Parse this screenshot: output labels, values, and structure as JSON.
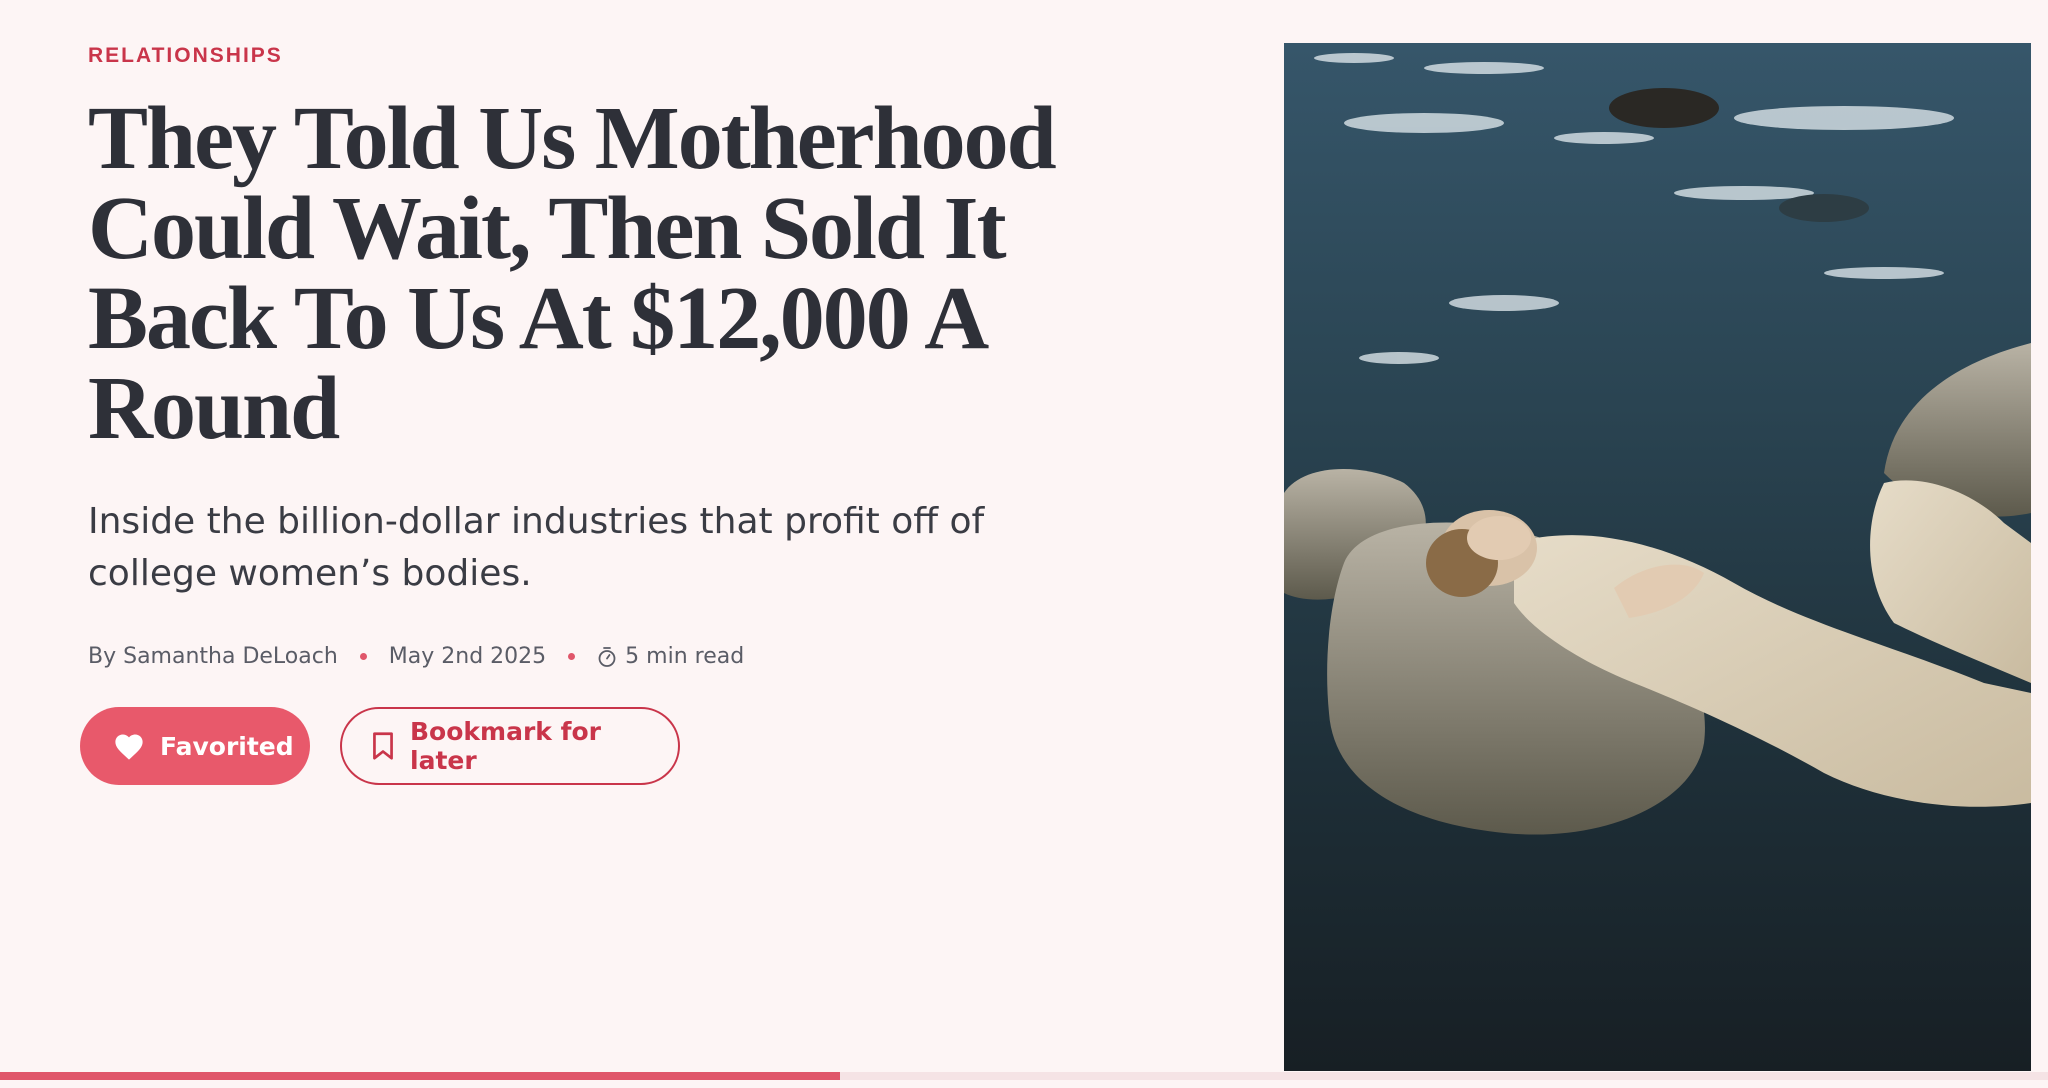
{
  "article": {
    "category": "RELATIONSHIPS",
    "headline": "They Told Us Motherhood Could Wait, Then Sold It Back To Us At $12,000 A Round",
    "dek": "Inside the billion-dollar industries that profit off of college women’s bodies.",
    "byline": "By Samantha DeLoach",
    "date": "May 2nd 2025",
    "read_time": "5 min read"
  },
  "actions": {
    "favorite_label": "Favorited",
    "bookmark_label": "Bookmark for later"
  },
  "icons": {
    "favorite": "heart-icon",
    "bookmark": "bookmark-icon",
    "read_time": "timer-icon"
  },
  "colors": {
    "accent": "#e0566a",
    "category": "#c9354a",
    "background": "#fdf5f5",
    "text": "#2e3038"
  },
  "reading_progress": 0.41
}
